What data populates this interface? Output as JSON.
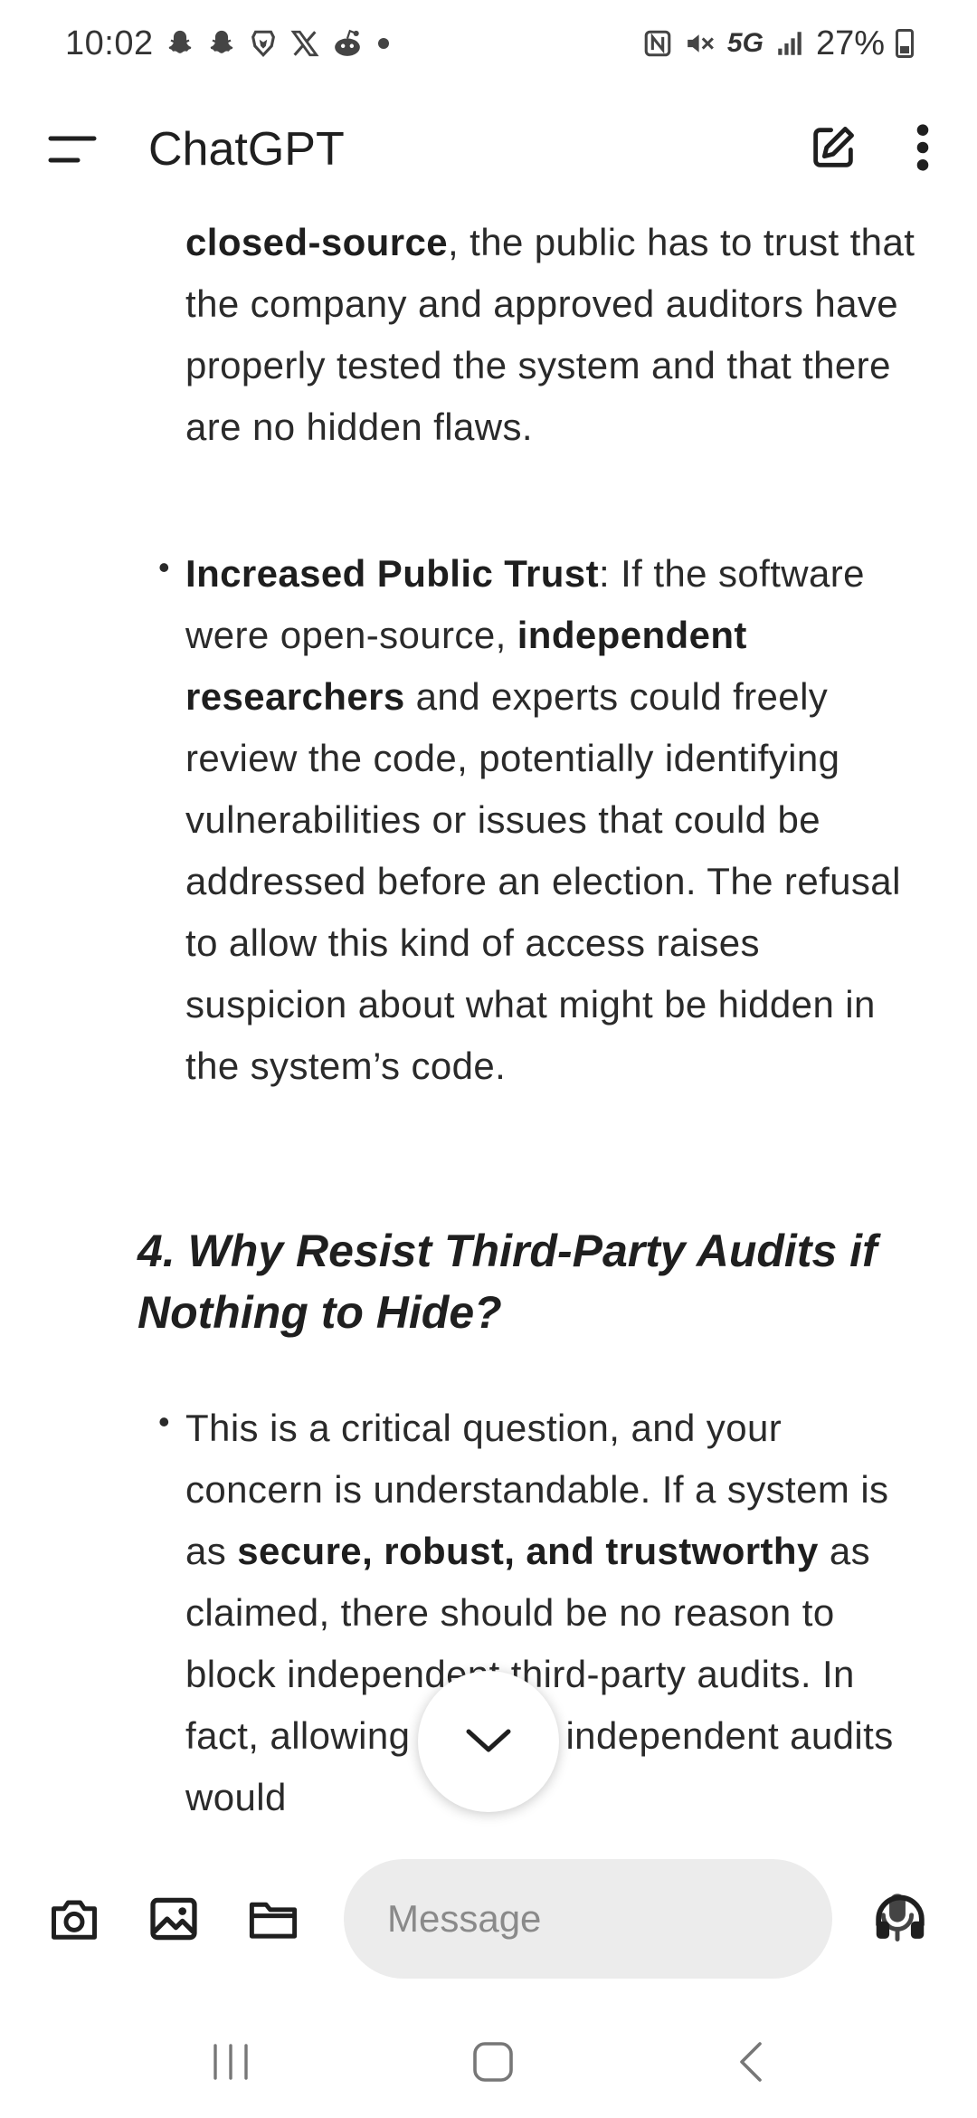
{
  "status_bar": {
    "time": "10:02",
    "network": "5G",
    "battery": "27%"
  },
  "app_bar": {
    "title": "ChatGPT"
  },
  "content": {
    "para1": {
      "bold_start": "closed-source",
      "rest": ", the public has to trust that the company and approved auditors have properly tested the system and that there are no hidden flaws."
    },
    "para2": {
      "bold_title": "Increased Public Trust",
      "text1": ": If the software were open-source, ",
      "bold_mid": "independent researchers",
      "text2": " and experts could freely review the code, potentially identifying vulnerabilities or issues that could be addressed before an election. The refusal to allow this kind of access raises suspicion about what might be hidden in the system’s code."
    },
    "heading": "4. Why Resist Third-Party Audits if Nothing to Hide?",
    "para3": {
      "text1": "This is a critical question, and your concern is understandable. If a system is as ",
      "bold1": "secure, robust, and trustworthy",
      "text2": " as claimed, there should be no reason to block independent third-party audits. In fact, allowing multiple independent audits would"
    },
    "bullet_char": "•"
  },
  "composer": {
    "placeholder": "Message"
  },
  "icons": {
    "menu": "menu-icon",
    "new_chat": "new-chat-icon",
    "more": "more-vert-icon",
    "camera": "camera-icon",
    "image": "image-icon",
    "folder": "folder-icon",
    "mic": "mic-icon",
    "headphones": "headphones-icon",
    "scroll_down": "chevron-down-icon"
  }
}
